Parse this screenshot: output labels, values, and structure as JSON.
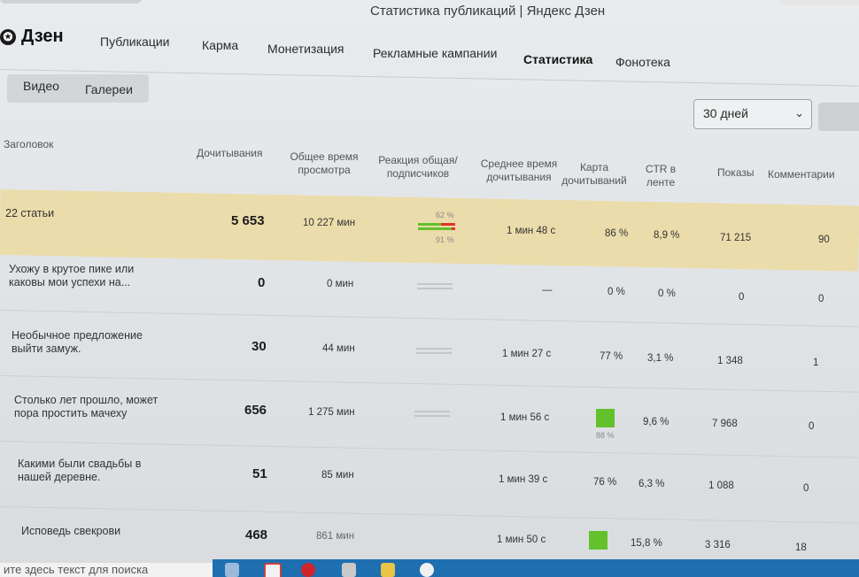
{
  "window": {
    "title": "Статистика публикаций | Яндекс Дзен"
  },
  "brand": {
    "name": "Дзен",
    "mark": "✪"
  },
  "nav": {
    "items": [
      {
        "label": "Публикации"
      },
      {
        "label": "Карма"
      },
      {
        "label": "Монетизация"
      },
      {
        "label": "Рекламные кампании"
      },
      {
        "label": "Статистика"
      },
      {
        "label": "Фонотека"
      }
    ],
    "active": "Статистика"
  },
  "subtabs": [
    {
      "label": "Видео"
    },
    {
      "label": "Галереи"
    }
  ],
  "period": {
    "label": "30 дней",
    "icon": "chevron-down-icon"
  },
  "table": {
    "headers": {
      "title": "Заголовок",
      "reads": "Дочитывания",
      "total_time": "Общее время просмотра",
      "reaction": "Реакция общая/ подписчиков",
      "avg_time": "Среднее время дочитывания",
      "map": "Карта дочитываний",
      "ctr": "CTR в ленте",
      "views": "Показы",
      "comments": "Комментарии"
    },
    "summary": {
      "title": "22 статьи",
      "reads": "5 653",
      "total_time": "10 227 мин",
      "reaction_total": "62 %",
      "reaction_subs": "91 %",
      "reaction_total_value": 62,
      "reaction_subs_value": 91,
      "avg_time": "1 мин 48 с",
      "map": "86 %",
      "ctr": "8,9 %",
      "views": "71 215",
      "comments": "90"
    },
    "rows": [
      {
        "title": "Ухожу в крутое пике или каковы мои успехи на...",
        "reads": "0",
        "total_time": "0 мин",
        "avg_time": "—",
        "map": "0 %",
        "ctr": "0 %",
        "views": "0",
        "comments": "0"
      },
      {
        "title": "Необычное предложение выйти замуж.",
        "reads": "30",
        "total_time": "44 мин",
        "avg_time": "1 мин 27 с",
        "map": "77 %",
        "ctr": "3,1 %",
        "views": "1 348",
        "comments": "1"
      },
      {
        "title": "Столько лет прошло, может пора простить мачеху",
        "reads": "656",
        "total_time": "1 275 мин",
        "avg_time": "1 мин 56 с",
        "map": "88 %",
        "ctr": "9,6 %",
        "views": "7 968",
        "comments": "0"
      },
      {
        "title": "Какими были свадьбы в нашей деревне.",
        "reads": "51",
        "total_time": "85 мин",
        "avg_time": "1 мин 39 с",
        "map": "76 %",
        "ctr": "6,3 %",
        "views": "1 088",
        "comments": "0"
      },
      {
        "title": "Исповедь свекрови",
        "reads": "468",
        "total_time": "861 мин",
        "avg_time": "1 мин 50 с",
        "map": "",
        "ctr": "15,8 %",
        "views": "3 316",
        "comments": "18"
      }
    ]
  },
  "taskbar": {
    "search_placeholder": "ите здесь текст для поиска"
  },
  "colors": {
    "highlight": "#ebdcab",
    "green": "#63c12c",
    "red": "#e0322a",
    "taskbar": "#1e6fb0"
  }
}
